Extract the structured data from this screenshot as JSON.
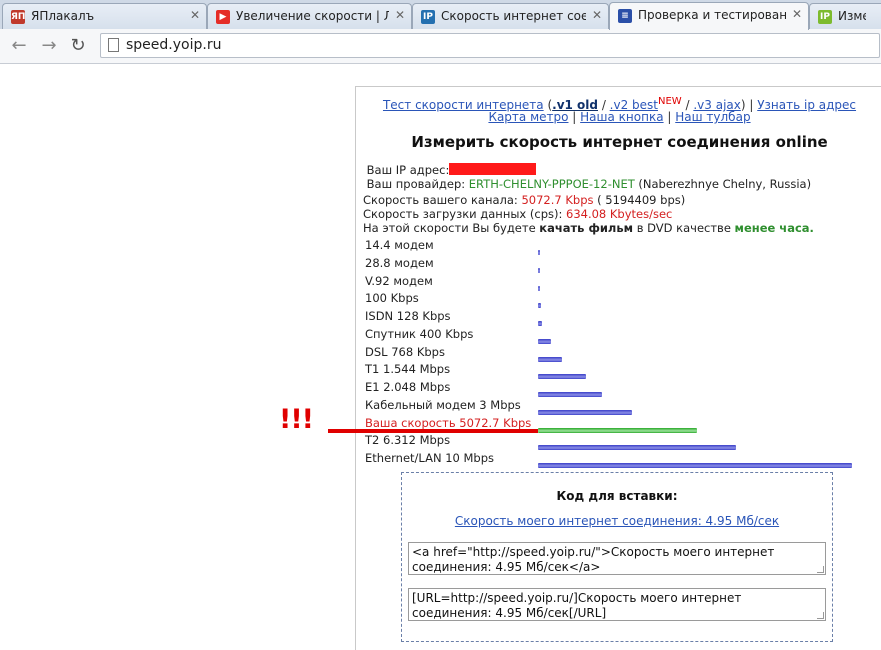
{
  "browser": {
    "tabs": [
      {
        "title": "ЯПлакалъ",
        "icon": "yaplakal-icon",
        "icon_text": "ЯП",
        "icon_color": "#c0392b"
      },
      {
        "title": "Увеличение скорости | Л",
        "icon": "youtube-icon",
        "icon_text": "▶",
        "icon_color": "#e52d27"
      },
      {
        "title": "Скорость интернет соед",
        "icon": "ip-icon",
        "icon_text": "IP",
        "icon_color": "#2470b0"
      },
      {
        "title": "Проверка и тестировани",
        "icon": "speed-icon",
        "icon_text": "≡",
        "icon_color": "#2b4fa8"
      },
      {
        "title": "Измер",
        "icon": "ip-green-icon",
        "icon_text": "IP",
        "icon_color": "#7dbb2e"
      }
    ],
    "active_tab": 3,
    "url": "speed.yoip.ru"
  },
  "nav": {
    "test_link": "Тест скорости интернета",
    "v1": ".v1 old",
    "v2": ".v2 best",
    "new_badge": "NEW",
    "v3": ".v3 ajax",
    "ip_link": "Узнать ip адрес",
    "metro_link": "Карта метро",
    "button_link": "Наша кнопка",
    "toolbar_link": "Наш тулбар"
  },
  "headline": "Измерить скорость интернет соединения online",
  "info": {
    "ip_label": "Ваш IP адрес:",
    "provider_label": "Ваш провайдер:",
    "provider_name": "ERTH-CHELNY-PPPOE-12-NET",
    "provider_location": "(Naberezhnye Chelny, Russia)",
    "channel_label": "Скорость вашего канала:",
    "channel_speed": "5072.7 Kbps",
    "channel_bps": "( 5194409 bps)",
    "download_label": "Скорость загрузки данных (cps):",
    "download_speed": "634.08 Kbytes/sec",
    "note_1": "На этой скорости Вы будете",
    "note_2": "качать фильм",
    "note_3": "в DVD качестве",
    "note_4": "менее часа."
  },
  "speed_rows": [
    {
      "label": "14.4 модем",
      "kbps": 14.4
    },
    {
      "label": "28.8 модем",
      "kbps": 28.8
    },
    {
      "label": "V.92 модем",
      "kbps": 56
    },
    {
      "label": "100 Kbps",
      "kbps": 100
    },
    {
      "label": "ISDN 128 Kbps",
      "kbps": 128
    },
    {
      "label": "Спутник 400 Kbps",
      "kbps": 400
    },
    {
      "label": "DSL 768 Kbps",
      "kbps": 768
    },
    {
      "label": "T1 1.544 Mbps",
      "kbps": 1544
    },
    {
      "label": "E1 2.048 Mbps",
      "kbps": 2048
    },
    {
      "label": "Кабельный модем 3 Mbps",
      "kbps": 3000
    },
    {
      "label": "Ваша скорость 5072.7 Kbps",
      "kbps": 5072.7,
      "highlight": true
    },
    {
      "label": "T2 6.312 Mbps",
      "kbps": 6312
    },
    {
      "label": "Ethernet/LAN 10 Mbps",
      "kbps": 10000
    }
  ],
  "annotation": "!!!",
  "embed": {
    "title": "Код для вставки:",
    "link": "Скорость моего интернет соединения: 4.95 Мб/сек",
    "html_code": "<a href=\"http://speed.yoip.ru/\">Скорость моего интернет соединения: 4.95 Мб/сек</a>",
    "bb_code": "[URL=http://speed.yoip.ru/]Скорость моего интернет соединения: 4.95 Мб/сек[/URL]"
  },
  "colors": {
    "link": "#2a55b8",
    "highlight_red": "#d42020",
    "green": "#2f8f2f",
    "bar_blue": "#3a3fc8",
    "bar_green": "#2aa82a"
  }
}
